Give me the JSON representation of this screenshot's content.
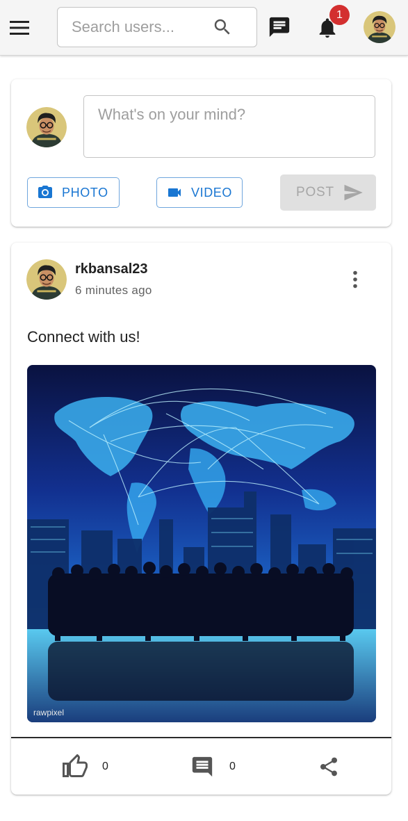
{
  "header": {
    "search": {
      "placeholder": "Search users...",
      "value": ""
    },
    "notifications": {
      "badge_count": "1"
    },
    "icons": [
      "menu-icon",
      "search-icon",
      "chat-icon",
      "bell-icon"
    ]
  },
  "composer": {
    "placeholder": "What's on your mind?",
    "photo_label": "PHOTO",
    "video_label": "VIDEO",
    "post_label": "POST",
    "post_enabled": false,
    "accent_color": "#1976d2"
  },
  "post": {
    "username": "rkbansal23",
    "time": "6 minutes ago",
    "text": "Connect with us!",
    "image_watermark": "rawpixel",
    "likes": "0",
    "comments": "0"
  }
}
